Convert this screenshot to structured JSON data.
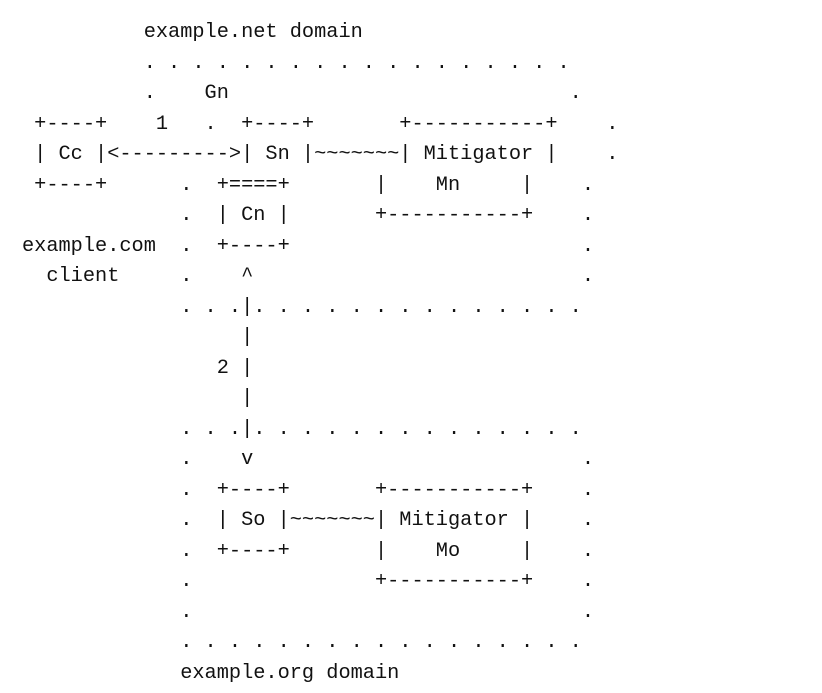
{
  "diagram": {
    "lines": [
      "          example.net domain",
      "          . . . . . . . . . . . . . . . . . .",
      "          .    Gn                            .",
      " +----+    1   .  +----+       +-----------+    .",
      " | Cc |<--------->| Sn |~~~~~~~| Mitigator |    .",
      " +----+      .  +====+       |    Mn     |    .",
      "             .  | Cn |       +-----------+    .",
      "example.com  .  +----+                        .",
      "  client     .    ^                           .",
      "             . . .|. . . . . . . . . . . . . .",
      "                  |",
      "                2 |",
      "                  |",
      "             . . .|. . . . . . . . . . . . . .",
      "             .    v                           .",
      "             .  +----+       +-----------+    .",
      "             .  | So |~~~~~~~| Mitigator |    .",
      "             .  +----+       |    Mo     |    .",
      "             .               +-----------+    .",
      "             .                                .",
      "             . . . . . . . . . . . . . . . . .",
      "             example.org domain"
    ]
  }
}
